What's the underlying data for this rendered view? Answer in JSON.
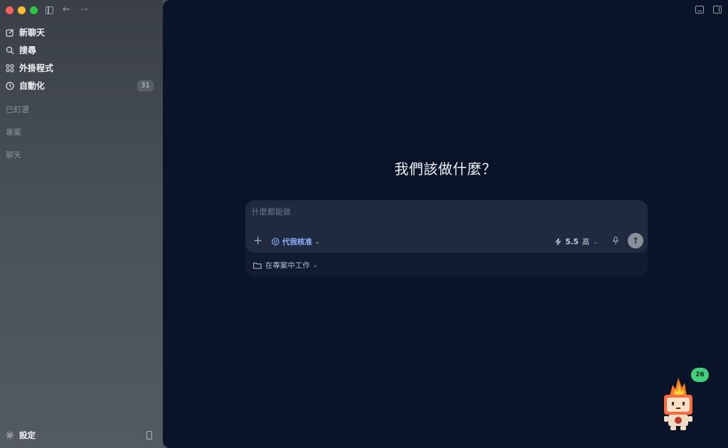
{
  "sidebar": {
    "nav": [
      {
        "label": "新聊天",
        "icon": "compose-icon"
      },
      {
        "label": "搜尋",
        "icon": "search-icon"
      },
      {
        "label": "外掛程式",
        "icon": "plugins-icon"
      },
      {
        "label": "自動化",
        "icon": "clock-icon",
        "badge": "31"
      }
    ],
    "sections": {
      "pinned": "已釘選",
      "projects": "專案",
      "chats": "聊天"
    },
    "settings_label": "設定"
  },
  "main": {
    "headline": "我們該做什麼？",
    "composer": {
      "placeholder": "什麼都能做",
      "mode_label": "代我核准",
      "model_version": "5.5",
      "effort_label": "高",
      "project_label": "在專案中工作"
    }
  },
  "mascot": {
    "badge_count": "26"
  },
  "colors": {
    "main_bg": "#0a1428",
    "accent": "#8fb3ff",
    "badge_green": "#3ed07a"
  }
}
